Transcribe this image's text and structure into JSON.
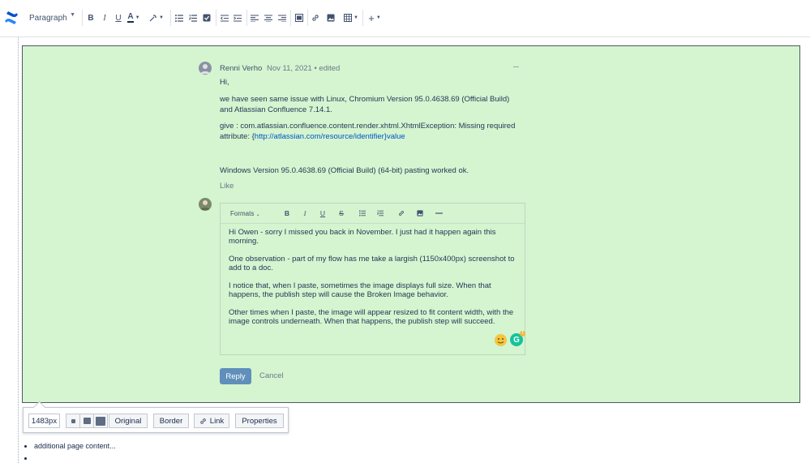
{
  "toolbar": {
    "logo_icon": "confluence-logo-icon",
    "paragraph_label": "Paragraph",
    "buttons": [
      "bold-icon",
      "italic-icon",
      "underline-icon",
      "text-color-icon",
      "text-effects-icon",
      "bullet-list-icon",
      "numbered-list-icon",
      "task-list-icon",
      "outdent-icon",
      "indent-icon",
      "align-left-icon",
      "align-center-icon",
      "align-right-icon",
      "layout-icon",
      "link-icon",
      "image-icon",
      "table-icon",
      "insert-more-icon"
    ]
  },
  "comment": {
    "author": "Renni Verho",
    "date": "Nov 11, 2021 • edited",
    "more_label": "···",
    "greeting": "Hi,",
    "p1": "we have seen same issue with Linux,  Chromium Version 95.0.4638.69 (Official Build) and Atlassian Confluence 7.14.1.",
    "p2_text": "give : com.atlassian.confluence.content.render.xhtml.XhtmlException: Missing required attribute: {",
    "p2_link": "http://atlassian.com/resource/identifier}value",
    "p3": "Windows Version 95.0.4638.69 (Official Build) (64-bit) pasting worked ok.",
    "like": "Like"
  },
  "reply_editor": {
    "formats_label": "Formats",
    "paragraphs": [
      "Hi Owen - sorry I missed you back in November.  I just had it happen again this morning.",
      "One observation - part of my flow has me take a largish (1150x400px) screenshot to add to a doc.",
      "I notice that, when I paste, sometimes the image displays full size.  When that happens, the publish step will cause the Broken Image behavior.",
      "Other times when I paste, the image will appear resized to fit content width, with the image controls underneath.  When that happens, the publish step will succeed."
    ],
    "grammarly_label": "G",
    "grammarly_badge": "1",
    "reply_label": "Reply",
    "cancel_label": "Cancel"
  },
  "image_toolbar": {
    "width_value": "1483px",
    "original_label": "Original",
    "border_label": "Border",
    "link_label": "Link",
    "properties_label": "Properties"
  },
  "page": {
    "list_items": [
      "additional page content...",
      ""
    ]
  }
}
